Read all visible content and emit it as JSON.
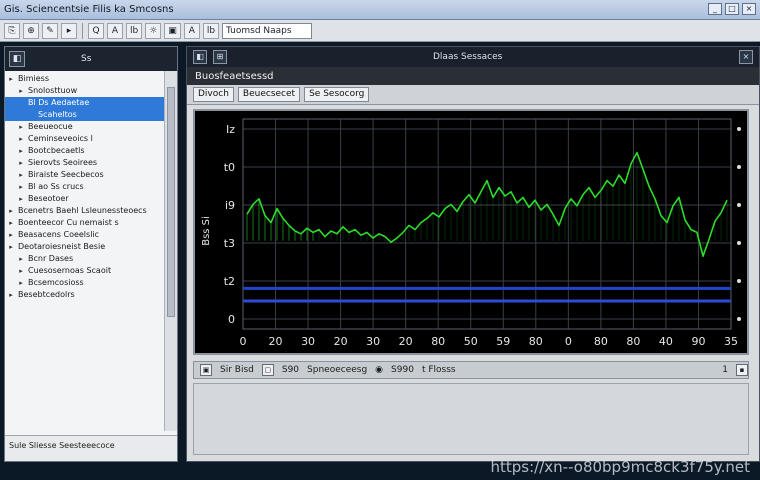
{
  "window": {
    "title": "Gis.  Sciencentsie  Filis  ka  Smcosns",
    "controls": [
      "_",
      "□",
      "×"
    ]
  },
  "toolbar": {
    "buttons": [
      "⎘",
      "⊕",
      "✎",
      "▸",
      "Q",
      "A",
      "lb",
      "☼",
      "▣",
      "A",
      "lb"
    ],
    "field_value": "Tuomsd  Naaps"
  },
  "left_panel": {
    "header_icon": "◧",
    "header_label": "Ss",
    "tree": [
      {
        "label": "Bimiess",
        "twisty": "▸",
        "indent": 0,
        "selected": false
      },
      {
        "label": "Snolosttuow",
        "twisty": "▸",
        "indent": 1,
        "selected": false
      },
      {
        "label": "Bl  Ds  Aedaetae",
        "twisty": "",
        "indent": 1,
        "selected": true
      },
      {
        "label": "Scaheltos",
        "twisty": "",
        "indent": 2,
        "selected": true
      },
      {
        "label": "Beeueocue",
        "twisty": "▸",
        "indent": 1,
        "selected": false
      },
      {
        "label": "Ceminseveoics  l",
        "twisty": "▸",
        "indent": 1,
        "selected": false
      },
      {
        "label": "Bootcbecaetls",
        "twisty": "▸",
        "indent": 1,
        "selected": false
      },
      {
        "label": "Sierovts  Seoirees",
        "twisty": "▸",
        "indent": 1,
        "selected": false
      },
      {
        "label": "Biraiste  Seecbecos",
        "twisty": "▸",
        "indent": 1,
        "selected": false
      },
      {
        "label": "Bl  ao  Ss  crucs",
        "twisty": "▸",
        "indent": 1,
        "selected": false
      },
      {
        "label": "Beseotoer",
        "twisty": "▸",
        "indent": 1,
        "selected": false
      },
      {
        "label": "Bcenetrs  Baehl  Lsleunessteoecs",
        "twisty": "▸",
        "indent": 0,
        "selected": false
      },
      {
        "label": "Boenteecor  Cu  nemaist  s",
        "twisty": "▸",
        "indent": 0,
        "selected": false
      },
      {
        "label": "Beasacens  Coeelslic",
        "twisty": "▸",
        "indent": 0,
        "selected": false
      },
      {
        "label": "Deotaroiesneist  Besie",
        "twisty": "▸",
        "indent": 0,
        "selected": false
      },
      {
        "label": "Bcnr  Dases",
        "twisty": "▸",
        "indent": 1,
        "selected": false
      },
      {
        "label": "Cuesosernoas  Scaoit",
        "twisty": "▸",
        "indent": 1,
        "selected": false
      },
      {
        "label": "Bcsemcosioss",
        "twisty": "▸",
        "indent": 1,
        "selected": false
      },
      {
        "label": "Besebtcedolrs",
        "twisty": "▸",
        "indent": 0,
        "selected": false
      }
    ],
    "status": "Sule   Sliesse   Seesteeecoce"
  },
  "main": {
    "head_icons": [
      "◧",
      "⊞"
    ],
    "head_title": "Dlaas  Sessaces",
    "panel_title": "Buosfeaetsessd",
    "chart_toolbar": [
      "Divoch",
      "Beuecsecet",
      "Se  Sesocorg"
    ],
    "status_row": {
      "box1": "▣",
      "value1": "Sir Bisd",
      "box2": "▢",
      "value2": "S90",
      "label": "Spneoeceesg",
      "marker": "◉",
      "code": "S990",
      "flag": "t  Flosss",
      "right": "1"
    }
  },
  "chart_data": {
    "type": "line",
    "x_ticks": [
      "0",
      "20",
      "30",
      "20",
      "30",
      "20",
      "80",
      "50",
      "59",
      "80",
      "0",
      "80",
      "80",
      "40",
      "90",
      "35"
    ],
    "y_ticks_left": [
      "Iz",
      "t0",
      "i9",
      "t3",
      "t2",
      "0"
    ],
    "ylabel": "Bss Si",
    "series": [
      {
        "color": "#2ddc2a",
        "values": [
          8.2,
          8.9,
          9.3,
          8.1,
          7.6,
          8.6,
          7.9,
          7.4,
          7.0,
          6.8,
          7.2,
          6.9,
          7.1,
          6.6,
          7.0,
          6.8,
          7.3,
          6.9,
          7.1,
          6.7,
          6.9,
          6.5,
          6.8,
          6.6,
          6.2,
          6.5,
          6.9,
          7.4,
          7.1,
          7.6,
          7.9,
          8.3,
          8.0,
          8.6,
          8.9,
          8.4,
          9.1,
          9.6,
          9.0,
          9.8,
          10.6,
          9.4,
          10.1,
          9.5,
          9.8,
          9.0,
          9.4,
          8.7,
          9.2,
          8.5,
          8.9,
          8.2,
          7.4,
          8.6,
          9.3,
          8.8,
          9.6,
          10.1,
          9.4,
          9.9,
          10.6,
          10.2,
          11.0,
          10.4,
          11.8,
          12.6,
          11.4,
          10.2,
          9.3,
          8.1,
          7.6,
          8.8,
          9.4,
          7.8,
          7.1,
          6.9,
          5.2,
          6.4,
          7.7,
          8.3,
          9.2
        ]
      }
    ],
    "bands": [
      {
        "y": 2.9,
        "color": "#2346c8"
      },
      {
        "y": 2.0,
        "color": "#2c4bd6"
      }
    ],
    "ylim": [
      0,
      15
    ],
    "grid": true
  },
  "watermark": "https://xn--o80bp9mc8ck3f75y.net"
}
